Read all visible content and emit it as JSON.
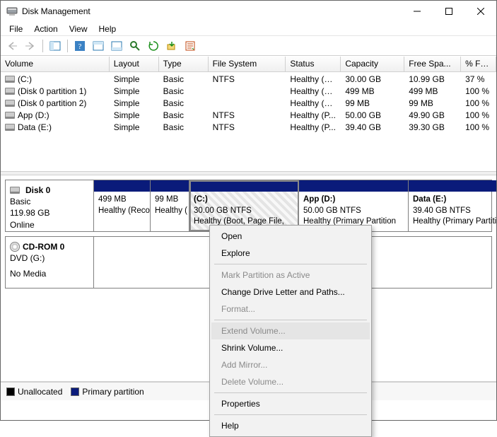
{
  "window": {
    "title": "Disk Management"
  },
  "menu": {
    "file": "File",
    "action": "Action",
    "view": "View",
    "help": "Help"
  },
  "columns": {
    "volume": "Volume",
    "layout": "Layout",
    "type": "Type",
    "fs": "File System",
    "status": "Status",
    "capacity": "Capacity",
    "free": "Free Spa...",
    "pct": "% Free"
  },
  "volumes": [
    {
      "name": "(C:)",
      "layout": "Simple",
      "type": "Basic",
      "fs": "NTFS",
      "status": "Healthy (B...",
      "capacity": "30.00 GB",
      "free": "10.99 GB",
      "pct": "37 %"
    },
    {
      "name": "(Disk 0 partition 1)",
      "layout": "Simple",
      "type": "Basic",
      "fs": "",
      "status": "Healthy (R...",
      "capacity": "499 MB",
      "free": "499 MB",
      "pct": "100 %"
    },
    {
      "name": "(Disk 0 partition 2)",
      "layout": "Simple",
      "type": "Basic",
      "fs": "",
      "status": "Healthy (E...",
      "capacity": "99 MB",
      "free": "99 MB",
      "pct": "100 %"
    },
    {
      "name": "App (D:)",
      "layout": "Simple",
      "type": "Basic",
      "fs": "NTFS",
      "status": "Healthy (P...",
      "capacity": "50.00 GB",
      "free": "49.90 GB",
      "pct": "100 %"
    },
    {
      "name": "Data (E:)",
      "layout": "Simple",
      "type": "Basic",
      "fs": "NTFS",
      "status": "Healthy (P...",
      "capacity": "39.40 GB",
      "free": "39.30 GB",
      "pct": "100 %"
    }
  ],
  "disk0": {
    "title": "Disk 0",
    "type": "Basic",
    "size": "119.98 GB",
    "state": "Online",
    "parts": [
      {
        "l1": "",
        "l2": "499 MB",
        "l3": "Healthy (Reco"
      },
      {
        "l1": "",
        "l2": "99 MB",
        "l3": "Healthy ("
      },
      {
        "l1": "(C:)",
        "l2": "30.00 GB NTFS",
        "l3": "Healthy (Boot, Page File,"
      },
      {
        "l1": "App  (D:)",
        "l2": "50.00 GB NTFS",
        "l3": "Healthy (Primary Partition"
      },
      {
        "l1": "Data  (E:)",
        "l2": "39.40 GB NTFS",
        "l3": "Healthy (Primary Partition"
      }
    ]
  },
  "cdrom": {
    "title": "CD-ROM 0",
    "line2": "DVD (G:)",
    "media": "No Media"
  },
  "legend": {
    "unallocated": "Unallocated",
    "primary": "Primary partition"
  },
  "ctx": {
    "open": "Open",
    "explore": "Explore",
    "mark": "Mark Partition as Active",
    "change": "Change Drive Letter and Paths...",
    "format": "Format...",
    "extend": "Extend Volume...",
    "shrink": "Shrink Volume...",
    "mirror": "Add Mirror...",
    "delete": "Delete Volume...",
    "props": "Properties",
    "help": "Help"
  }
}
